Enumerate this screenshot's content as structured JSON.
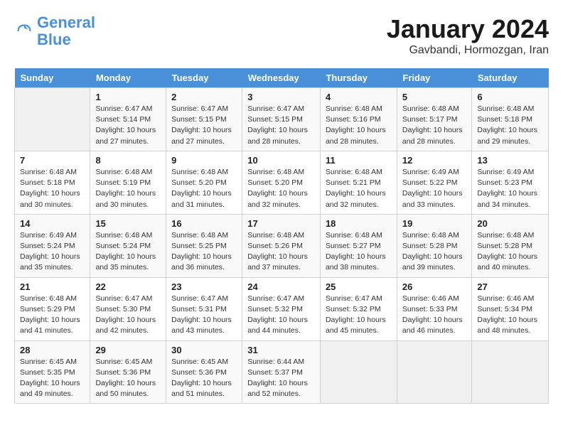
{
  "header": {
    "logo_line1": "General",
    "logo_line2": "Blue",
    "title": "January 2024",
    "subtitle": "Gavbandi, Hormozgan, Iran"
  },
  "calendar": {
    "headers": [
      "Sunday",
      "Monday",
      "Tuesday",
      "Wednesday",
      "Thursday",
      "Friday",
      "Saturday"
    ],
    "rows": [
      [
        {
          "empty": true
        },
        {
          "day": "1",
          "sunrise": "6:47 AM",
          "sunset": "5:14 PM",
          "daylight": "10 hours and 27 minutes."
        },
        {
          "day": "2",
          "sunrise": "6:47 AM",
          "sunset": "5:15 PM",
          "daylight": "10 hours and 27 minutes."
        },
        {
          "day": "3",
          "sunrise": "6:47 AM",
          "sunset": "5:15 PM",
          "daylight": "10 hours and 28 minutes."
        },
        {
          "day": "4",
          "sunrise": "6:48 AM",
          "sunset": "5:16 PM",
          "daylight": "10 hours and 28 minutes."
        },
        {
          "day": "5",
          "sunrise": "6:48 AM",
          "sunset": "5:17 PM",
          "daylight": "10 hours and 28 minutes."
        },
        {
          "day": "6",
          "sunrise": "6:48 AM",
          "sunset": "5:18 PM",
          "daylight": "10 hours and 29 minutes."
        }
      ],
      [
        {
          "day": "7",
          "sunrise": "6:48 AM",
          "sunset": "5:18 PM",
          "daylight": "10 hours and 30 minutes."
        },
        {
          "day": "8",
          "sunrise": "6:48 AM",
          "sunset": "5:19 PM",
          "daylight": "10 hours and 30 minutes."
        },
        {
          "day": "9",
          "sunrise": "6:48 AM",
          "sunset": "5:20 PM",
          "daylight": "10 hours and 31 minutes."
        },
        {
          "day": "10",
          "sunrise": "6:48 AM",
          "sunset": "5:20 PM",
          "daylight": "10 hours and 32 minutes."
        },
        {
          "day": "11",
          "sunrise": "6:48 AM",
          "sunset": "5:21 PM",
          "daylight": "10 hours and 32 minutes."
        },
        {
          "day": "12",
          "sunrise": "6:49 AM",
          "sunset": "5:22 PM",
          "daylight": "10 hours and 33 minutes."
        },
        {
          "day": "13",
          "sunrise": "6:49 AM",
          "sunset": "5:23 PM",
          "daylight": "10 hours and 34 minutes."
        }
      ],
      [
        {
          "day": "14",
          "sunrise": "6:49 AM",
          "sunset": "5:24 PM",
          "daylight": "10 hours and 35 minutes."
        },
        {
          "day": "15",
          "sunrise": "6:48 AM",
          "sunset": "5:24 PM",
          "daylight": "10 hours and 35 minutes."
        },
        {
          "day": "16",
          "sunrise": "6:48 AM",
          "sunset": "5:25 PM",
          "daylight": "10 hours and 36 minutes."
        },
        {
          "day": "17",
          "sunrise": "6:48 AM",
          "sunset": "5:26 PM",
          "daylight": "10 hours and 37 minutes."
        },
        {
          "day": "18",
          "sunrise": "6:48 AM",
          "sunset": "5:27 PM",
          "daylight": "10 hours and 38 minutes."
        },
        {
          "day": "19",
          "sunrise": "6:48 AM",
          "sunset": "5:28 PM",
          "daylight": "10 hours and 39 minutes."
        },
        {
          "day": "20",
          "sunrise": "6:48 AM",
          "sunset": "5:28 PM",
          "daylight": "10 hours and 40 minutes."
        }
      ],
      [
        {
          "day": "21",
          "sunrise": "6:48 AM",
          "sunset": "5:29 PM",
          "daylight": "10 hours and 41 minutes."
        },
        {
          "day": "22",
          "sunrise": "6:47 AM",
          "sunset": "5:30 PM",
          "daylight": "10 hours and 42 minutes."
        },
        {
          "day": "23",
          "sunrise": "6:47 AM",
          "sunset": "5:31 PM",
          "daylight": "10 hours and 43 minutes."
        },
        {
          "day": "24",
          "sunrise": "6:47 AM",
          "sunset": "5:32 PM",
          "daylight": "10 hours and 44 minutes."
        },
        {
          "day": "25",
          "sunrise": "6:47 AM",
          "sunset": "5:32 PM",
          "daylight": "10 hours and 45 minutes."
        },
        {
          "day": "26",
          "sunrise": "6:46 AM",
          "sunset": "5:33 PM",
          "daylight": "10 hours and 46 minutes."
        },
        {
          "day": "27",
          "sunrise": "6:46 AM",
          "sunset": "5:34 PM",
          "daylight": "10 hours and 48 minutes."
        }
      ],
      [
        {
          "day": "28",
          "sunrise": "6:45 AM",
          "sunset": "5:35 PM",
          "daylight": "10 hours and 49 minutes."
        },
        {
          "day": "29",
          "sunrise": "6:45 AM",
          "sunset": "5:36 PM",
          "daylight": "10 hours and 50 minutes."
        },
        {
          "day": "30",
          "sunrise": "6:45 AM",
          "sunset": "5:36 PM",
          "daylight": "10 hours and 51 minutes."
        },
        {
          "day": "31",
          "sunrise": "6:44 AM",
          "sunset": "5:37 PM",
          "daylight": "10 hours and 52 minutes."
        },
        {
          "empty": true
        },
        {
          "empty": true
        },
        {
          "empty": true
        }
      ]
    ]
  }
}
